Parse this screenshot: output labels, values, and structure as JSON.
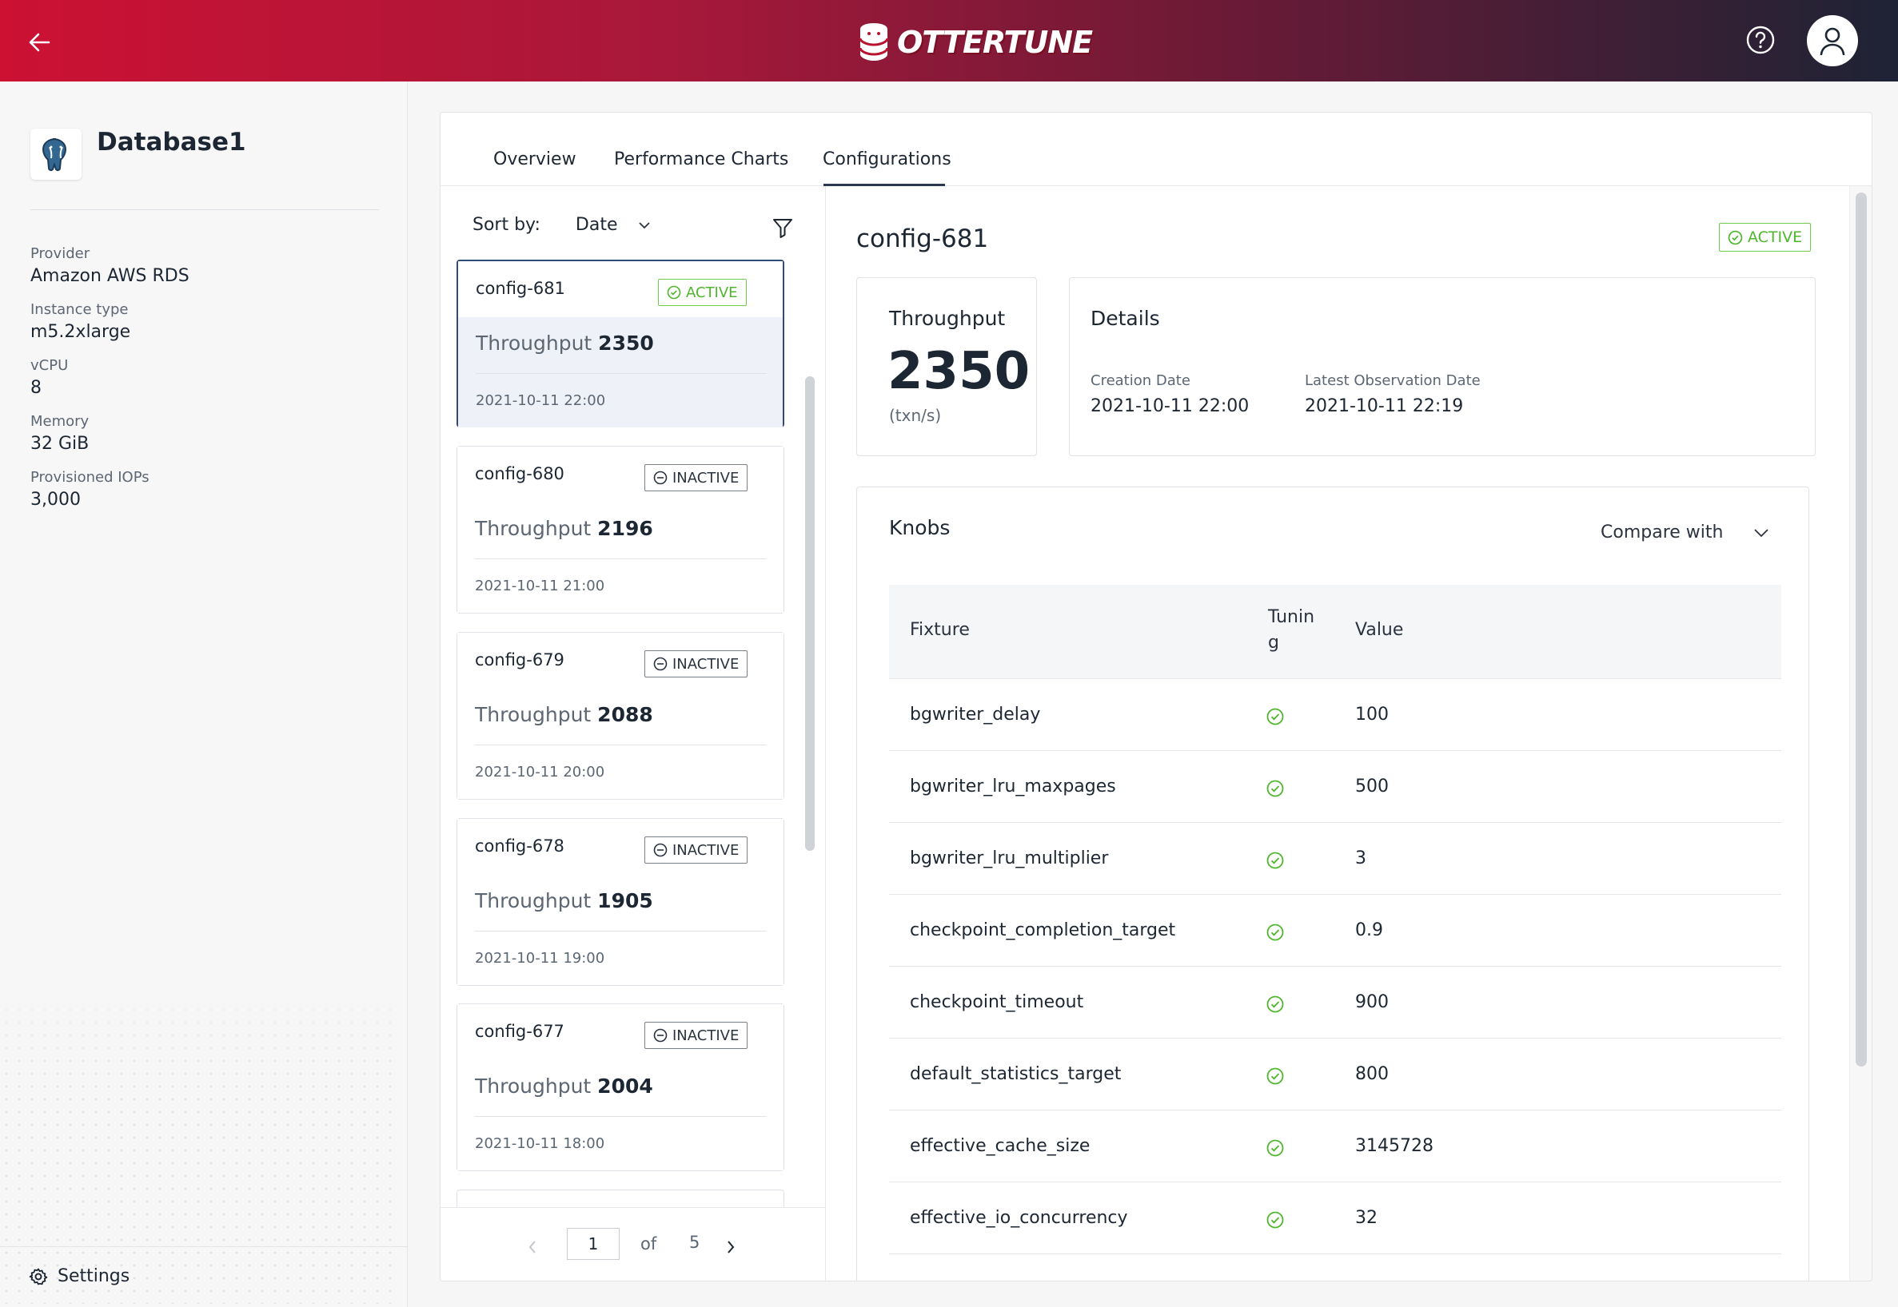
{
  "app": {
    "brand": "OTTERTUNE"
  },
  "sidebar": {
    "db_name": "Database1",
    "db_icon": "postgresql-elephant-icon",
    "properties": [
      {
        "label": "Provider",
        "value": "Amazon AWS RDS"
      },
      {
        "label": "Instance type",
        "value": "m5.2xlarge"
      },
      {
        "label": "vCPU",
        "value": "8"
      },
      {
        "label": "Memory",
        "value": "32 GiB"
      },
      {
        "label": "Provisioned IOPs",
        "value": "3,000"
      }
    ],
    "settings_label": "Settings"
  },
  "tabs": [
    {
      "label": "Overview"
    },
    {
      "label": "Performance Charts"
    },
    {
      "label": "Configurations",
      "selected": true
    }
  ],
  "list": {
    "sort_label": "Sort by:",
    "sort_value": "Date",
    "tp_label": "Throughput",
    "cards": [
      {
        "name": "config-681",
        "status": "ACTIVE",
        "throughput": "2350",
        "date": "2021-10-11 22:00",
        "selected": true
      },
      {
        "name": "config-680",
        "status": "INACTIVE",
        "throughput": "2196",
        "date": "2021-10-11 21:00"
      },
      {
        "name": "config-679",
        "status": "INACTIVE",
        "throughput": "2088",
        "date": "2021-10-11 20:00"
      },
      {
        "name": "config-678",
        "status": "INACTIVE",
        "throughput": "1905",
        "date": "2021-10-11 19:00"
      },
      {
        "name": "config-677",
        "status": "INACTIVE",
        "throughput": "2004",
        "date": "2021-10-11 18:00"
      }
    ],
    "pager": {
      "current": "1",
      "of_label": "of",
      "total": "5"
    }
  },
  "detail": {
    "title": "config-681",
    "status": "ACTIVE",
    "throughput_label": "Throughput",
    "throughput_value": "2350",
    "throughput_unit": "(txn/s)",
    "details_label": "Details",
    "creation_label": "Creation Date",
    "creation_value": "2021-10-11 22:00",
    "latest_label": "Latest Observation Date",
    "latest_value": "2021-10-11 22:19",
    "knobs_label": "Knobs",
    "compare_label": "Compare with",
    "table_headers": {
      "fixture": "Fixture",
      "tuning_line1": "Tunin",
      "tuning_line2": "g",
      "value": "Value"
    },
    "knobs": [
      {
        "name": "bgwriter_delay",
        "value": "100"
      },
      {
        "name": "bgwriter_lru_maxpages",
        "value": "500"
      },
      {
        "name": "bgwriter_lru_multiplier",
        "value": "3"
      },
      {
        "name": "checkpoint_completion_target",
        "value": "0.9"
      },
      {
        "name": "checkpoint_timeout",
        "value": "900"
      },
      {
        "name": "default_statistics_target",
        "value": "800"
      },
      {
        "name": "effective_cache_size",
        "value": "3145728"
      },
      {
        "name": "effective_io_concurrency",
        "value": "32"
      }
    ]
  },
  "colors": {
    "active_green": "#4fb52c",
    "header_start": "#cc1133",
    "header_end": "#1e2335",
    "selected_border": "#2f4a7c"
  }
}
